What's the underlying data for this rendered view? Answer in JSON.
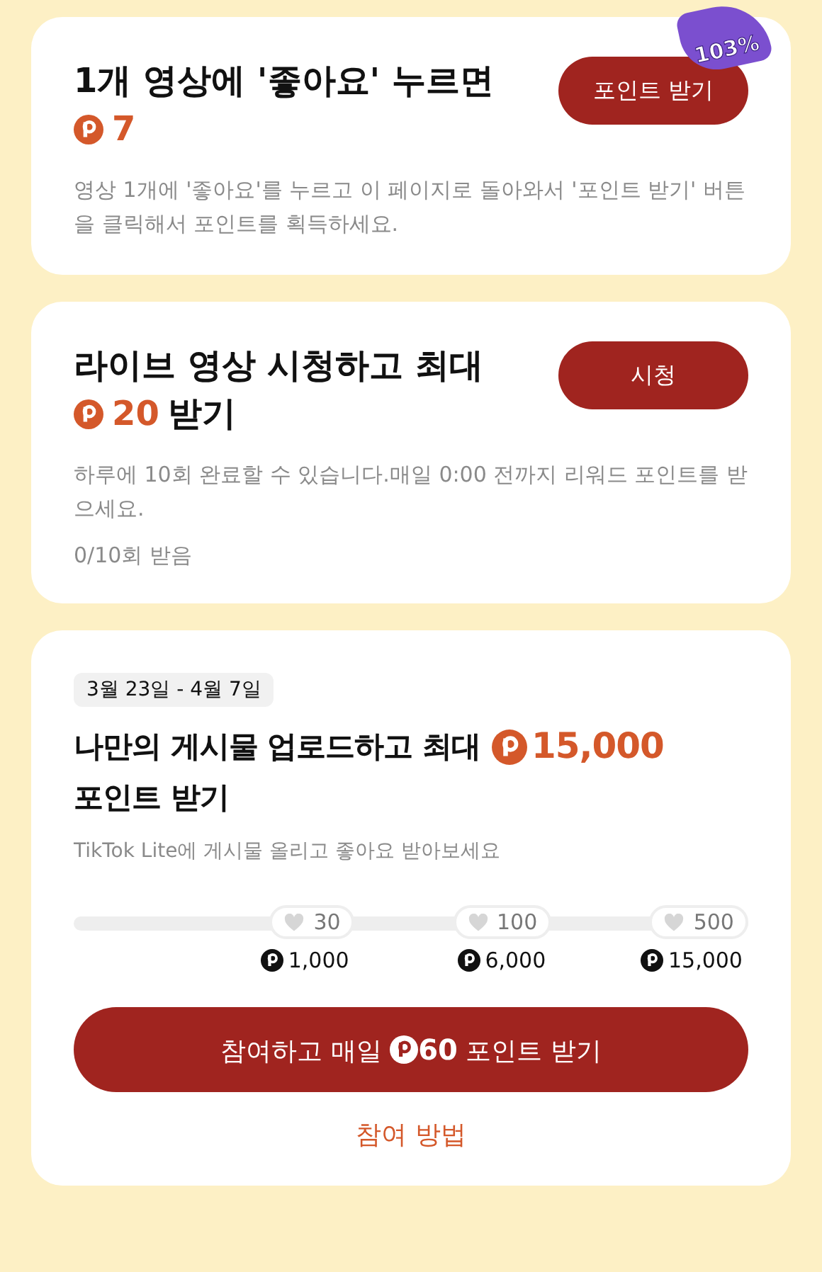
{
  "tasks": [
    {
      "title": "1개 영상에 '좋아요' 누르면",
      "reward": "7",
      "button": "포인트 받기",
      "badge": "103%",
      "description": "영상 1개에 '좋아요'를 누르고 이 페이지로 돌아와서 '포인트 받기' 버튼을 클릭해서 포인트를 획득하세요."
    },
    {
      "title": "라이브 영상 시청하고 최대",
      "reward": "20",
      "reward_suffix": "받기",
      "button": "시청",
      "description": "하루에 10회 완료할 수 있습니다.매일 0:00 전까지 리워드 포인트를 받으세요.",
      "progress": "0/10회 받음"
    }
  ],
  "campaign": {
    "date": "3월 23일 - 4월 7일",
    "title": "나만의 게시물 업로드하고 최대",
    "reward": "15,000",
    "title_end": "포인트 받기",
    "subtitle": "TikTok Lite에 게시물 올리고 좋아요 받아보세요",
    "milestones": [
      {
        "likes": "30",
        "points": "1,000"
      },
      {
        "likes": "100",
        "points": "6,000"
      },
      {
        "likes": "500",
        "points": "15,000"
      }
    ],
    "join_button": {
      "before": "참여하고 매일",
      "amount": "60",
      "after": "포인트 받기"
    },
    "how_link": "참여 방법"
  }
}
